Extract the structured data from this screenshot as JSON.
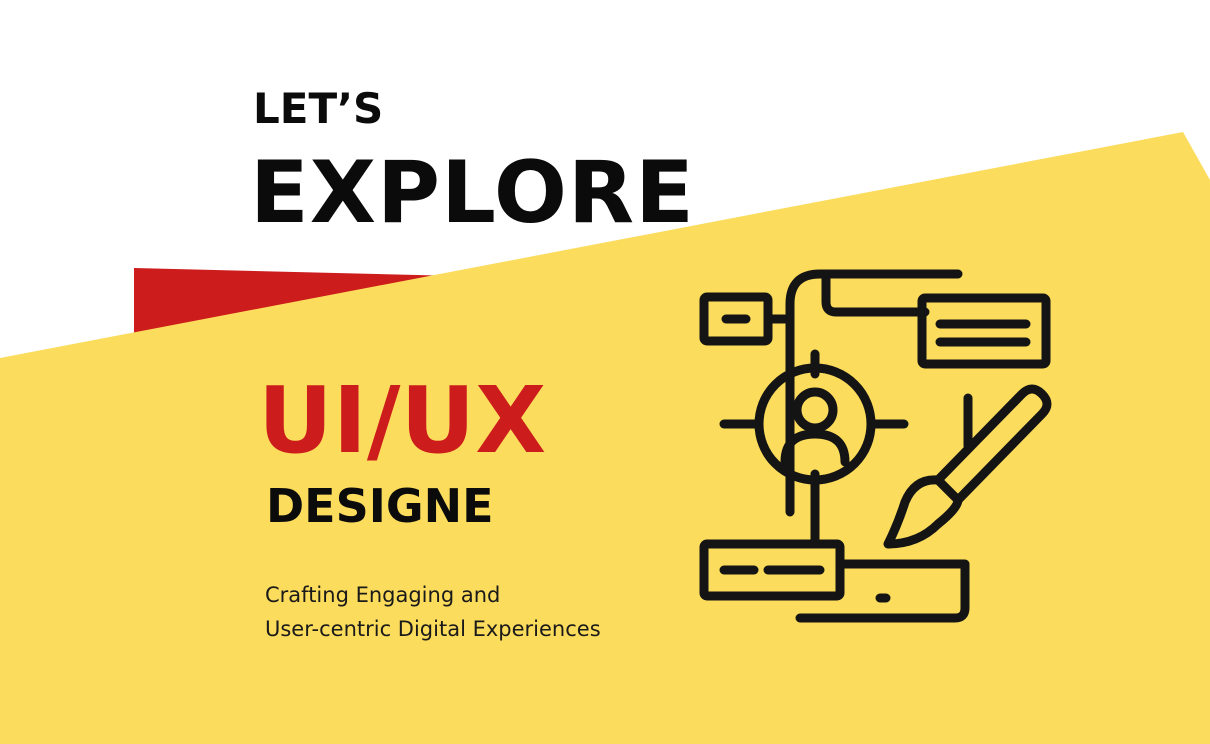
{
  "hero": {
    "kicker": "LET’S",
    "headline": "EXPLORE",
    "accent_title": "UI/UX",
    "subtitle": "DESIGNE",
    "tagline_line1": "Crafting Engaging and",
    "tagline_line2": "User-centric Digital Experiences"
  },
  "icons": {
    "main_illustration": "ui-ux-design-icon"
  },
  "colors": {
    "background": "#ffffff",
    "yellow_panel": "#fcdc5c",
    "red_accent": "#cc1c1c",
    "text_dark": "#0b0b0b"
  }
}
